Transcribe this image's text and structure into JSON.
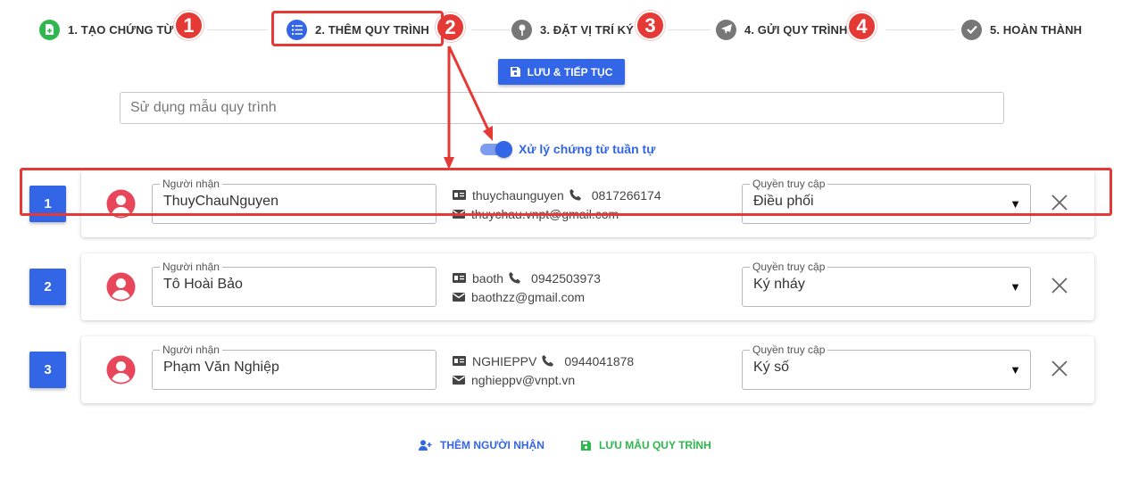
{
  "stepper": {
    "steps": [
      {
        "label": "1. TẠO CHỨNG TỪ",
        "icon": "document-icon",
        "color": "#2db84d"
      },
      {
        "label": "2. THÊM QUY TRÌNH",
        "icon": "list-icon",
        "color": "#3366e6"
      },
      {
        "label": "3. ĐẶT VỊ TRÍ KÝ",
        "icon": "pin-icon",
        "color": "#777777"
      },
      {
        "label": "4. GỬI QUY TRÌNH",
        "icon": "send-icon",
        "color": "#777777"
      },
      {
        "label": "5. HOÀN THÀNH",
        "icon": "check-icon",
        "color": "#777777"
      }
    ],
    "badges": [
      "1",
      "2",
      "3",
      "4"
    ]
  },
  "toolbar": {
    "save_continue_label": "LƯU & TIẾP TỤC"
  },
  "template": {
    "placeholder": "Sử dụng mẫu quy trình"
  },
  "sequential": {
    "label": "Xử lý chứng từ tuần tự",
    "enabled": true
  },
  "recipients": [
    {
      "order": "1",
      "field_label": "Người nhận",
      "name": "ThuyChauNguyen",
      "username": "thuychaunguyen",
      "phone": "0817266174",
      "email": "thuychau.vnpt@gmail.com",
      "access_label": "Quyền truy cập",
      "access": "Điều phối"
    },
    {
      "order": "2",
      "field_label": "Người nhận",
      "name": "Tô Hoài Bảo",
      "username": "baoth",
      "phone": "0942503973",
      "email": "baothzz@gmail.com",
      "access_label": "Quyền truy cập",
      "access": "Ký nháy"
    },
    {
      "order": "3",
      "field_label": "Người nhận",
      "name": "Phạm Văn Nghiệp",
      "username": "NGHIEPPV",
      "phone": "0944041878",
      "email": "nghieppv@vnpt.vn",
      "access_label": "Quyền truy cập",
      "access": "Ký số"
    }
  ],
  "actions": {
    "add_recipient": "THÊM NGƯỜI NHẬN",
    "save_template": "LƯU MẪU QUY TRÌNH"
  },
  "colors": {
    "primary": "#3366e6",
    "success": "#2db84d",
    "annotation": "#e53935",
    "avatar": "#e8465a"
  }
}
